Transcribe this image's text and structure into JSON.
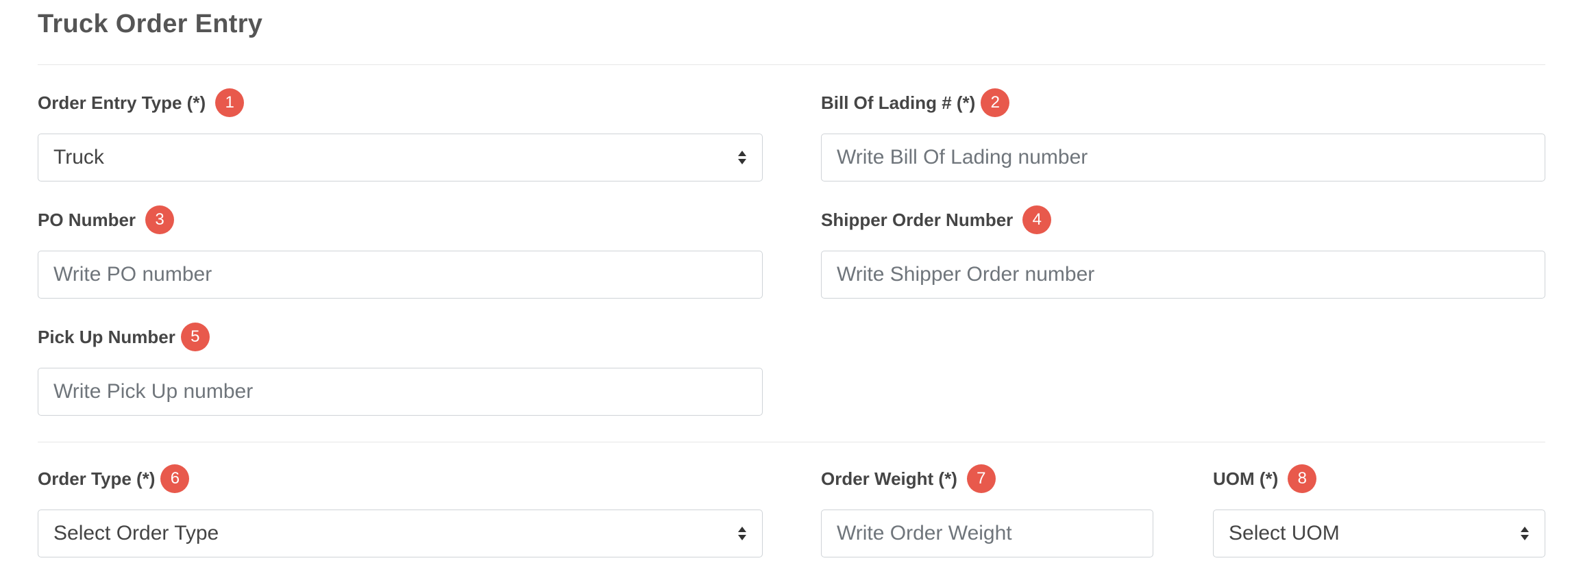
{
  "page": {
    "title": "Truck Order Entry"
  },
  "fields": {
    "order_entry_type": {
      "label": "Order Entry Type (*)",
      "badge": "1",
      "value": "Truck"
    },
    "bill_of_lading": {
      "label": "Bill Of Lading # (*)",
      "badge": "2",
      "placeholder": "Write Bill Of Lading number"
    },
    "po_number": {
      "label": "PO Number",
      "badge": "3",
      "placeholder": "Write PO number"
    },
    "shipper_order_number": {
      "label": "Shipper Order Number",
      "badge": "4",
      "placeholder": "Write Shipper Order number"
    },
    "pick_up_number": {
      "label": "Pick Up Number",
      "badge": "5",
      "placeholder": "Write Pick Up number"
    },
    "order_type": {
      "label": "Order Type (*)",
      "badge": "6",
      "value": "Select Order Type"
    },
    "order_weight": {
      "label": "Order Weight (*)",
      "badge": "7",
      "placeholder": "Write Order Weight"
    },
    "uom": {
      "label": "UOM (*)",
      "badge": "8",
      "value": "Select UOM"
    }
  },
  "colors": {
    "badge": "#e8594c",
    "border": "#cfd3d7",
    "placeholder": "#6f757b"
  },
  "icons": {
    "select_arrows": "sort-arrows-icon"
  }
}
